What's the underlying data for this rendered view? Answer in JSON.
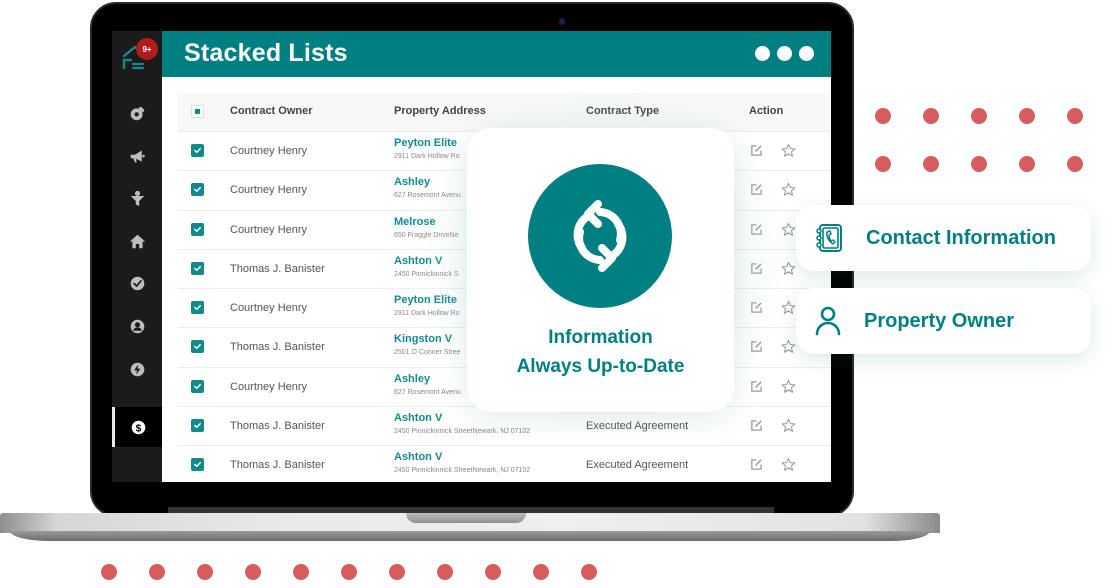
{
  "app": {
    "title": "Stacked Lists",
    "notification_badge": "9+",
    "colors": {
      "brand": "#007f82",
      "accent_dots": "#d65c5e",
      "badge": "#b01c1c",
      "sidebar": "#1b1b1b"
    }
  },
  "sidebar": {
    "items": [
      {
        "icon": "chart-pie-icon",
        "active": false
      },
      {
        "icon": "megaphone-icon",
        "active": false
      },
      {
        "icon": "funnel-dollar-icon",
        "active": false
      },
      {
        "icon": "home-icon",
        "active": false
      },
      {
        "icon": "check-circle-icon",
        "active": false
      },
      {
        "icon": "user-circle-icon",
        "active": false
      },
      {
        "icon": "bolt-circle-icon",
        "active": false
      },
      {
        "icon": "dollar-circle-icon",
        "active": true
      }
    ]
  },
  "header": {
    "menu_icon": "three-dots-icon"
  },
  "table": {
    "columns": [
      "Contract Owner",
      "Property Address",
      "Contract Type",
      "Action"
    ],
    "rows": [
      {
        "owner": "Courtney Henry",
        "property": "Peyton Elite",
        "address": "2911 Dark Hollow Ro",
        "type": "",
        "checked": true
      },
      {
        "owner": "Courtney Henry",
        "property": "Ashley",
        "address": "627 Rosemont Avenu",
        "type": "",
        "checked": true
      },
      {
        "owner": "Courtney Henry",
        "property": "Melrose",
        "address": "650 Fraggle DriveNe",
        "type": "",
        "checked": true
      },
      {
        "owner": "Thomas J. Banister",
        "property": "Ashton V",
        "address": "2450 Pinnickinnick S",
        "type": "",
        "checked": true
      },
      {
        "owner": "Courtney Henry",
        "property": "Peyton Elite",
        "address": "2911 Dark Hollow Ro",
        "type": "",
        "checked": true
      },
      {
        "owner": "Thomas J. Banister",
        "property": "Kingston V",
        "address": "2501 O Conner Stree",
        "type": "",
        "checked": true
      },
      {
        "owner": "Courtney Henry",
        "property": "Ashley",
        "address": "627 Rosemont Avenu",
        "type": "",
        "checked": true
      },
      {
        "owner": "Thomas J. Banister",
        "property": "Ashton V",
        "address": "2450 Pinnickinnick StreetNewark, NJ 07102",
        "type": "Executed Agreement",
        "checked": true
      },
      {
        "owner": "Thomas J. Banister",
        "property": "Ashton V",
        "address": "2450 Pinnickinnick StreetNewark, NJ 07102",
        "type": "Executed Agreement",
        "checked": true
      }
    ]
  },
  "feature_card": {
    "icon": "sync-icon",
    "line1": "Information",
    "line2": "Always Up-to-Date"
  },
  "pills": [
    {
      "icon": "contact-book-icon",
      "label": "Contact Information"
    },
    {
      "icon": "user-icon",
      "label": "Property Owner"
    }
  ]
}
